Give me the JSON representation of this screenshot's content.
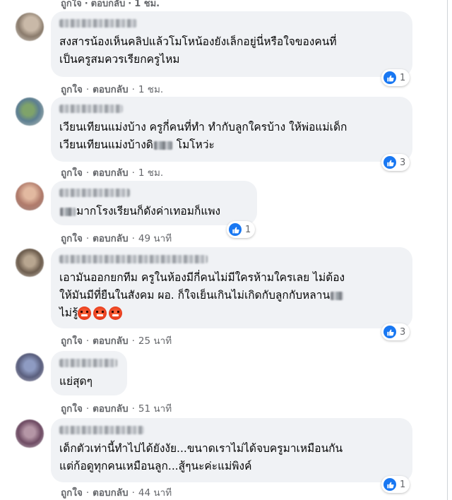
{
  "top": {
    "like": "ถูกใจ",
    "reply": "ตอบกลับ",
    "time": "1 ชม."
  },
  "comments": [
    {
      "lines": [
        "สงสารน้องเห็นคลิปแล้วโมโหน้องยังเล็กอยู่นี่หรือใจของคนที่",
        "เป็นครูสมควรเรียกครูไหม"
      ],
      "reactions": "1",
      "like": "ถูกใจ",
      "reply": "ตอบกลับ",
      "time": "1 ชม."
    },
    {
      "lines": [
        "เวียนเทียนแม่งบ้าง ครูกี่คนที่ทำ ทำกับลูกใครบ้าง ให้พ่อแม่เด็ก",
        "เวียนเทียนแม่งบ้างดิ",
        "โมโหว่ะ"
      ],
      "reactions": "3",
      "like": "ถูกใจ",
      "reply": "ตอบกลับ",
      "time": "1 ชม."
    },
    {
      "lines": [
        "มากโรงเรียนก็ดังค่าเทอมก็แพง"
      ],
      "reactions": "1",
      "like": "ถูกใจ",
      "reply": "ตอบกลับ",
      "time": "49 นาที"
    },
    {
      "lines": [
        "เอามันออกยกทีม ครูในห้องมีกี่คนไม่มีใครห้ามใครเลย ไม่ต้อง",
        "ให้มันมีที่ยืนในสังคม ผอ. ก็ใจเย็นเกินไม่เกิดกับลูกกับหลาน",
        "ไม่รู้"
      ],
      "reactions": "3",
      "like": "ถูกใจ",
      "reply": "ตอบกลับ",
      "time": "25 นาที"
    },
    {
      "lines": [
        "แย่สุดๆ"
      ],
      "like": "ถูกใจ",
      "reply": "ตอบกลับ",
      "time": "51 นาที"
    },
    {
      "lines": [
        "เด็กตัวเท่านี้ทำไปได้ยังงัย...ขนาดเราไม่ได้จบครูมาเหมือนกัน",
        "แต่ก้อดูทุกคนเหมือนลูก...สู้ๆนะค่ะแม่พิงค์"
      ],
      "reactions": "1",
      "like": "ถูกใจ",
      "reply": "ตอบกลับ",
      "time": "44 นาที"
    }
  ],
  "icons": {
    "reaction": "like-thumbs-up-icon"
  },
  "colors": {
    "bubble": "#f0f2f5",
    "like_blue": "#1877f2",
    "meta_gray": "#65676b"
  }
}
